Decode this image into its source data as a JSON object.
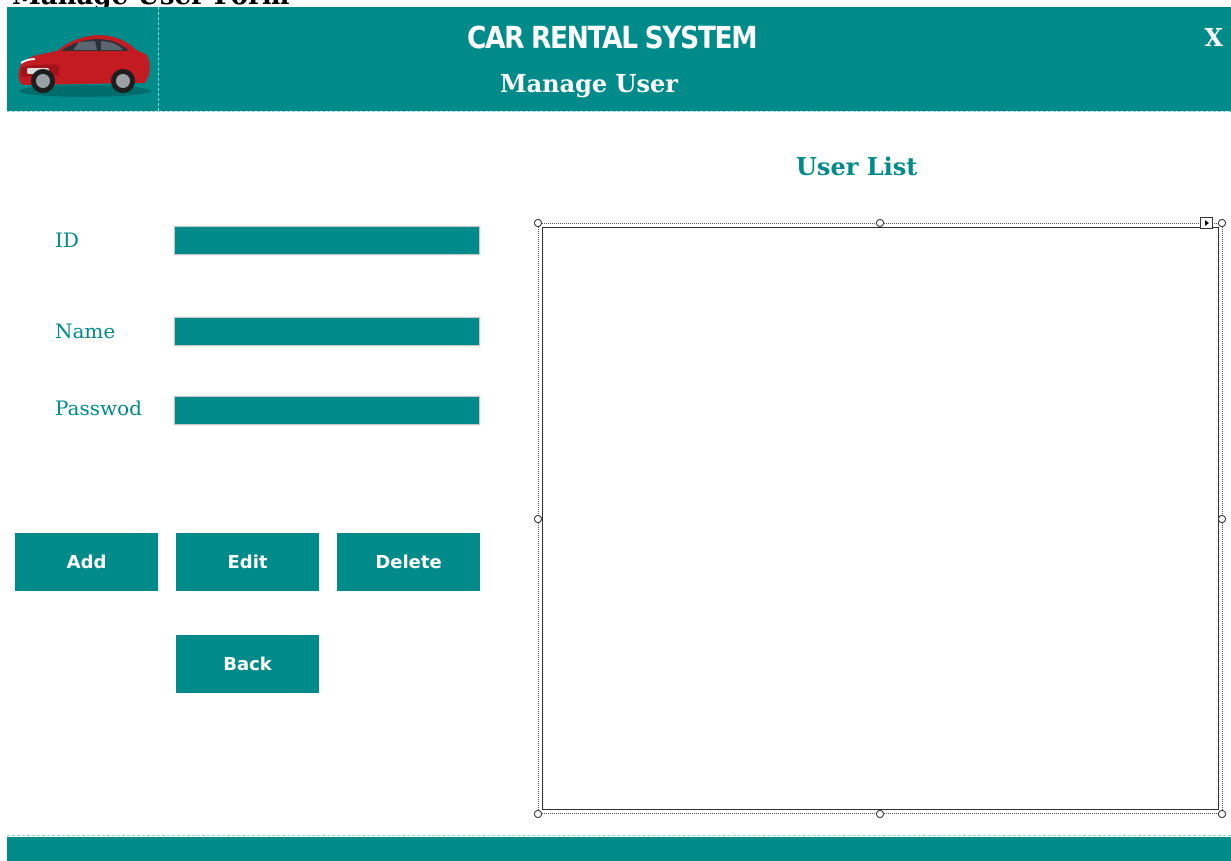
{
  "window": {
    "caption": "Manage User Form"
  },
  "header": {
    "title": "CAR RENTAL SYSTEM",
    "subtitle": "Manage User",
    "close_label": "X",
    "logo_icon": "car-logo-icon"
  },
  "form": {
    "id_label": "ID",
    "id_value": "",
    "name_label": "Name",
    "name_value": "",
    "password_label": "Passwod",
    "password_value": ""
  },
  "buttons": {
    "add": "Add",
    "edit": "Edit",
    "delete": "Delete",
    "back": "Back"
  },
  "user_list": {
    "title": "User List",
    "rows": []
  },
  "colors": {
    "accent": "#008b8b",
    "text_on_accent": "#ffffff",
    "background": "#ffffff"
  }
}
